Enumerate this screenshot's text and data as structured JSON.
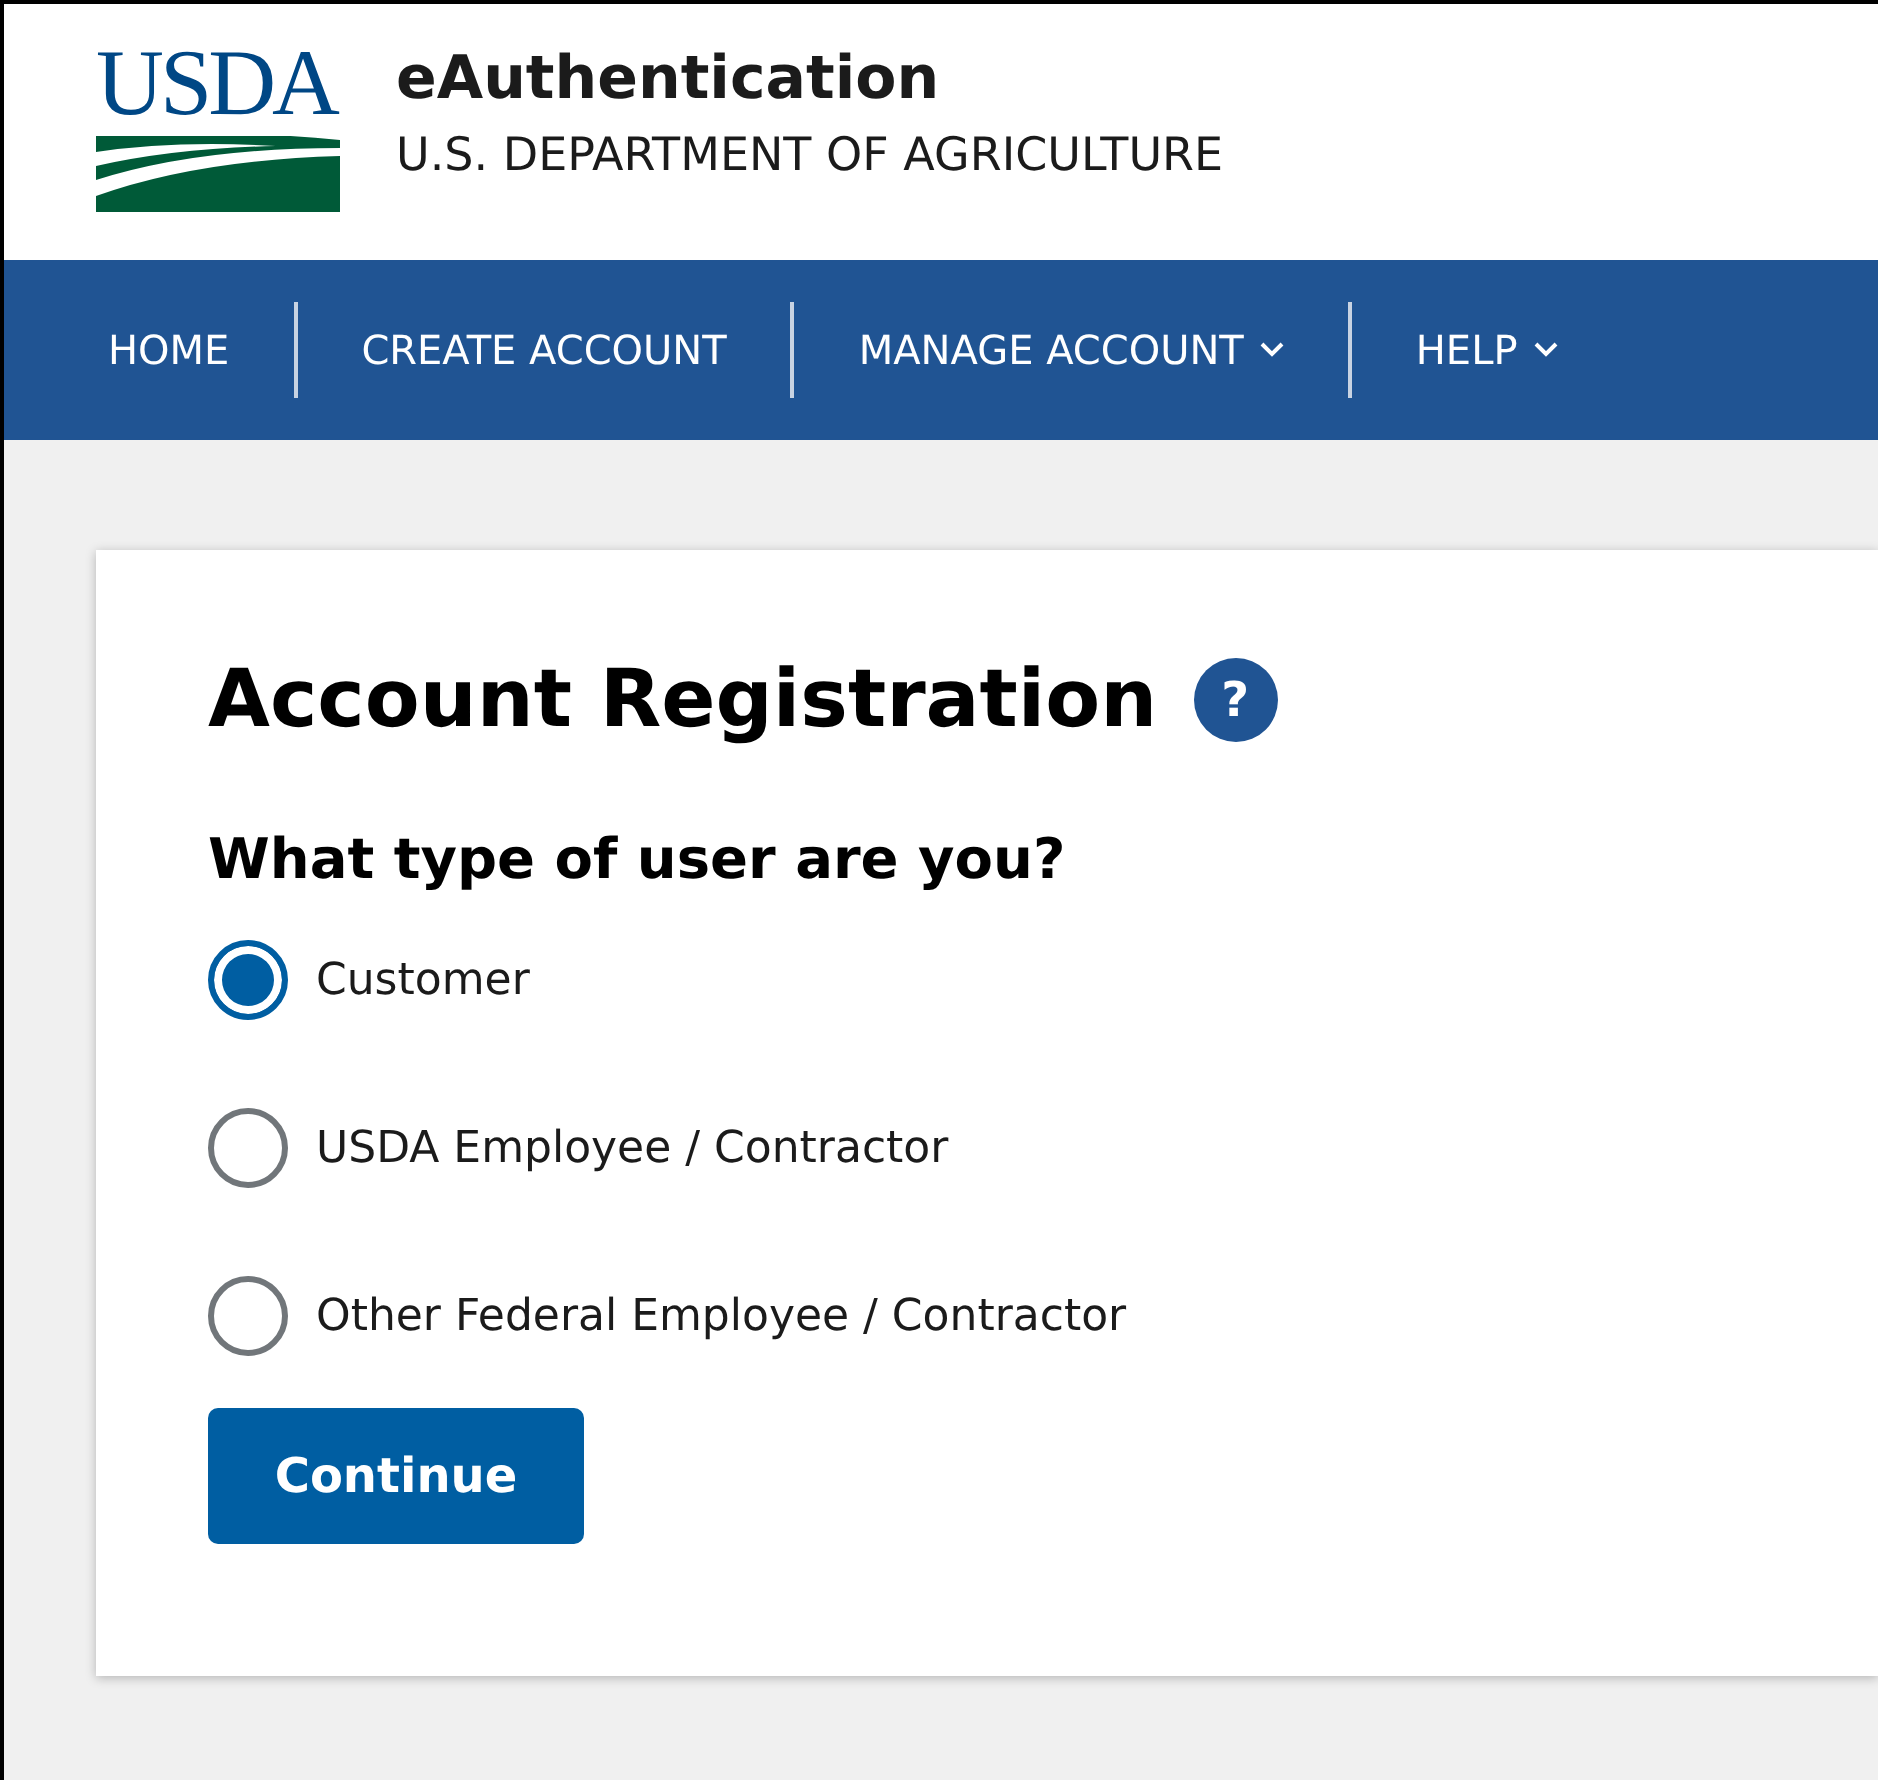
{
  "header": {
    "logo_text": "USDA",
    "title": "eAuthentication",
    "subtitle": "U.S. DEPARTMENT OF AGRICULTURE"
  },
  "nav": [
    {
      "label": "HOME",
      "has_menu": false
    },
    {
      "label": "CREATE ACCOUNT",
      "has_menu": false
    },
    {
      "label": "MANAGE ACCOUNT",
      "has_menu": true
    },
    {
      "label": "HELP",
      "has_menu": true
    }
  ],
  "card": {
    "title": "Account Registration",
    "help_icon": "?",
    "question": "What type of user are you?",
    "options": [
      {
        "label": "Customer",
        "selected": true
      },
      {
        "label": "USDA Employee / Contractor",
        "selected": false
      },
      {
        "label": "Other Federal Employee / Contractor",
        "selected": false
      }
    ],
    "button": "Continue"
  }
}
